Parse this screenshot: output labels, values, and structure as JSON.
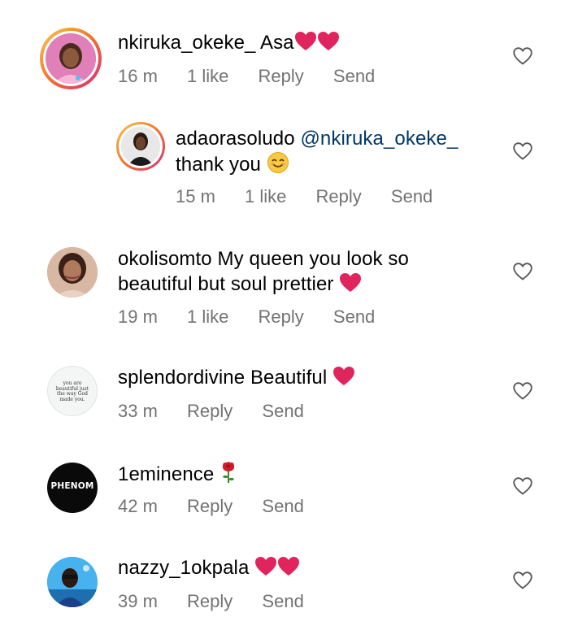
{
  "comments": [
    {
      "username": "nkiruka_okeke_",
      "text": "Asa",
      "emojis": [
        "red-heart",
        "red-heart"
      ],
      "time": "16 m",
      "likes": "1 like",
      "reply": "Reply",
      "send": "Send"
    },
    {
      "username": "adaorasoludo",
      "mention": "@nkiruka_okeke_",
      "text": "thank you",
      "emojis": [
        "smiling-face"
      ],
      "time": "15 m",
      "likes": "1 like",
      "reply": "Reply",
      "send": "Send"
    },
    {
      "username": "okolisomto",
      "text_line1": "My queen you look so",
      "text_line2": "beautiful but soul prettier",
      "emojis": [
        "red-heart"
      ],
      "time": "19 m",
      "likes": "1 like",
      "reply": "Reply",
      "send": "Send"
    },
    {
      "username": "splendordivine",
      "text": "Beautiful",
      "emojis": [
        "red-heart"
      ],
      "avatar_text": [
        "you are",
        "beautiful just",
        "the way God",
        "made you."
      ],
      "time": "33 m",
      "reply": "Reply",
      "send": "Send"
    },
    {
      "username": "1eminence",
      "text": "",
      "emojis": [
        "rose"
      ],
      "avatar_text": "PHENOM",
      "time": "42 m",
      "reply": "Reply",
      "send": "Send"
    },
    {
      "username": "nazzy_1okpala",
      "text": "",
      "emojis": [
        "red-heart",
        "red-heart"
      ],
      "time": "39 m",
      "reply": "Reply",
      "send": "Send"
    }
  ],
  "colors": {
    "text": "#000000",
    "meta": "#737373",
    "mention": "#00376b",
    "heart": "#e0245e",
    "story_ring": "#f5a623"
  },
  "icons": {
    "like": "heart-outline-icon"
  }
}
